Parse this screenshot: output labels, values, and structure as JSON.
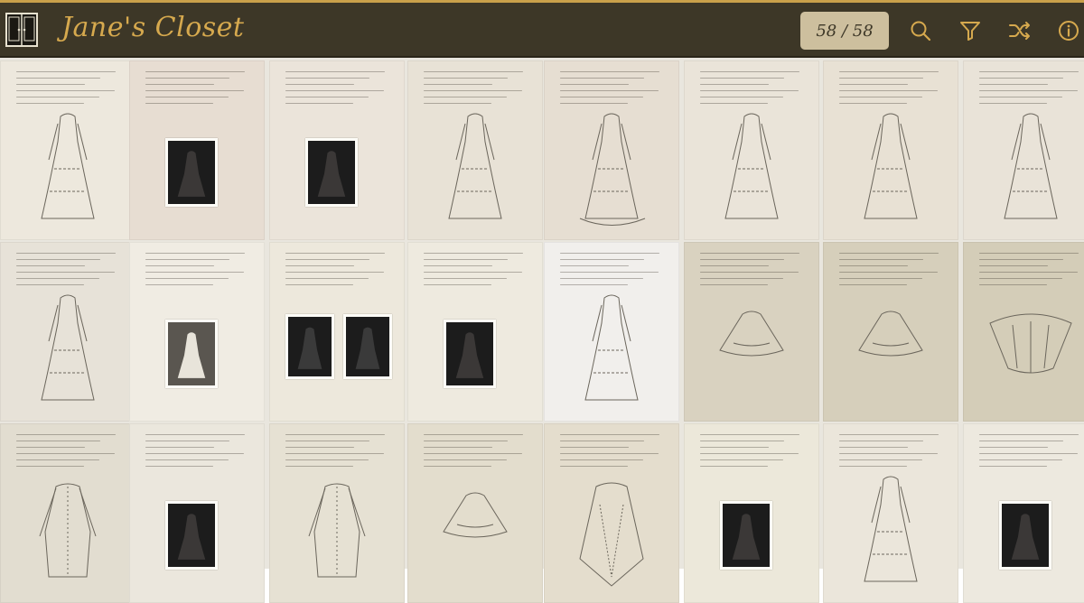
{
  "app": {
    "title": "Jane's Closet",
    "counter": "58 / 58"
  },
  "toolbar": {
    "icons": [
      "search-icon",
      "filter-icon",
      "shuffle-icon",
      "info-icon"
    ]
  },
  "colors": {
    "header_bg": "#3d3727",
    "accent_gold": "#d6a94e",
    "counter_bg": "#cdbf9e"
  },
  "gallery": {
    "items": [
      {
        "tone": "#ede8dd",
        "kind": "sketch-dress"
      },
      {
        "tone": "#e7ddd2",
        "kind": "photo-dress"
      },
      {
        "tone": "#ebe4da",
        "kind": "photo-dress"
      },
      {
        "tone": "#e8e2d6",
        "kind": "sketch-dress"
      },
      {
        "tone": "#e6ded2",
        "kind": "sketch-gown"
      },
      {
        "tone": "#eae4d9",
        "kind": "sketch-dress"
      },
      {
        "tone": "#e8e1d4",
        "kind": "sketch-dress"
      },
      {
        "tone": "#e9e3d8",
        "kind": "sketch-dress"
      },
      {
        "tone": "#e7e2d8",
        "kind": "sketch-dress"
      },
      {
        "tone": "#f0ece3",
        "kind": "photo-gown"
      },
      {
        "tone": "#ede8dc",
        "kind": "photo-double"
      },
      {
        "tone": "#eeeadf",
        "kind": "photo-dress"
      },
      {
        "tone": "#f1efec",
        "kind": "sketch-dress"
      },
      {
        "tone": "#d9d2c0",
        "kind": "sketch-cape"
      },
      {
        "tone": "#d6cfbb",
        "kind": "sketch-cape"
      },
      {
        "tone": "#d4cdb8",
        "kind": "sketch-fan"
      },
      {
        "tone": "#e2ddd0",
        "kind": "sketch-jacket"
      },
      {
        "tone": "#ebe7dd",
        "kind": "photo-dress"
      },
      {
        "tone": "#e6e1d3",
        "kind": "sketch-coat"
      },
      {
        "tone": "#e3ddcd",
        "kind": "sketch-cape"
      },
      {
        "tone": "#e4ddcd",
        "kind": "sketch-shawl"
      },
      {
        "tone": "#ece8da",
        "kind": "photo-dress"
      },
      {
        "tone": "#ebe6db",
        "kind": "sketch-dress"
      },
      {
        "tone": "#ede9df",
        "kind": "photo-dress"
      }
    ]
  }
}
